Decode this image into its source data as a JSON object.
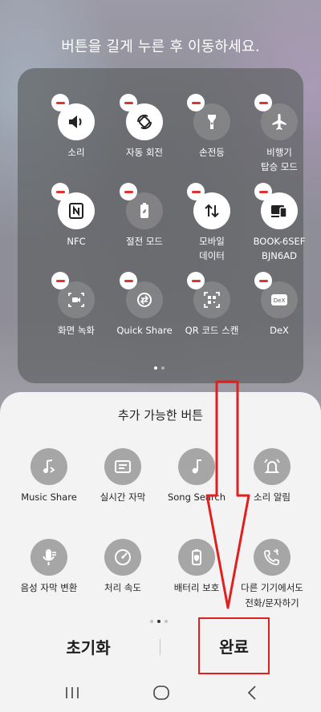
{
  "hint": "버튼을 길게 누른 후 이동하세요.",
  "active_buttons": [
    {
      "label": "소리",
      "icon": "speaker-icon",
      "on": true
    },
    {
      "label": "자동 회전",
      "icon": "auto-rotate-icon",
      "on": true
    },
    {
      "label": "손전등",
      "icon": "flashlight-icon",
      "on": false
    },
    {
      "label": "비행기\n탑승 모드",
      "icon": "airplane-icon",
      "on": false
    },
    {
      "label": "NFC",
      "icon": "nfc-icon",
      "on": true
    },
    {
      "label": "절전 모드",
      "icon": "power-saving-icon",
      "on": false
    },
    {
      "label": "모바일\n데이터",
      "icon": "mobile-data-icon",
      "on": true
    },
    {
      "label": "BOOK-6SEF\nBJN6AD",
      "icon": "device-icon",
      "on": true
    },
    {
      "label": "화면 녹화",
      "icon": "screen-record-icon",
      "on": false
    },
    {
      "label": "Quick Share",
      "icon": "quick-share-icon",
      "on": false
    },
    {
      "label": "QR 코드 스캔",
      "icon": "qr-scan-icon",
      "on": false
    },
    {
      "label": "DeX",
      "icon": "dex-icon",
      "on": false
    }
  ],
  "available_title": "추가 가능한 버튼",
  "available_buttons": [
    {
      "label": "Music Share",
      "icon": "music-share-icon"
    },
    {
      "label": "실시간 자막",
      "icon": "live-caption-icon"
    },
    {
      "label": "Song Search",
      "icon": "song-search-icon"
    },
    {
      "label": "소리 알림",
      "icon": "sound-notification-icon"
    },
    {
      "label": "음성 자막 변환",
      "icon": "voice-caption-icon"
    },
    {
      "label": "처리 속도",
      "icon": "processing-speed-icon"
    },
    {
      "label": "배터리 보호",
      "icon": "battery-protect-icon"
    },
    {
      "label": "다른 기기에서도\n전화/문자하기",
      "icon": "call-continue-icon"
    }
  ],
  "reset_label": "초기화",
  "done_label": "완료",
  "colors": {
    "annotation": "#e02020",
    "minus": "#e0332e",
    "sheet": "#f3f3f3"
  }
}
